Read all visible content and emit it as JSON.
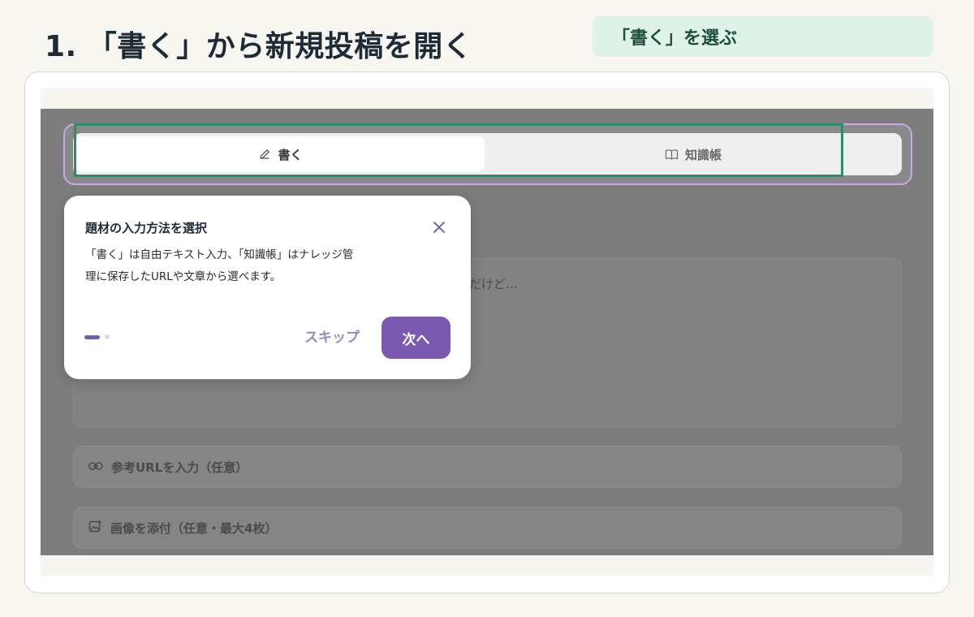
{
  "step": {
    "title": "1. 「書く」から新規投稿を開く",
    "badge": "「書く」を選ぶ"
  },
  "tabs": {
    "write_label": "書く",
    "write_icon": "pencil-icon",
    "knowledge_label": "知識帳",
    "knowledge_icon": "book-icon"
  },
  "popover": {
    "title": "題材の入力方法を選択",
    "body_line1": "「書く」は自由テキスト入力、「知識帳」はナレッジ管",
    "body_line2": "理に保存したURLや文章から選べます。",
    "skip_label": "スキップ",
    "next_label": "次へ",
    "close_icon": "close-icon",
    "step_current": 1,
    "step_total": 2
  },
  "form": {
    "textarea_placeholder": "だけど…",
    "url_placeholder": "参考URLを入力（任意）",
    "url_icon": "link-icon",
    "image_label": "画像を添付（任意・最大4枚）",
    "image_icon": "image-add-icon"
  },
  "colors": {
    "accent": "#7a5ab0",
    "highlight": "#2f8d6a",
    "badge_bg": "#dff2ea",
    "overlay": "#7d7d7d"
  }
}
